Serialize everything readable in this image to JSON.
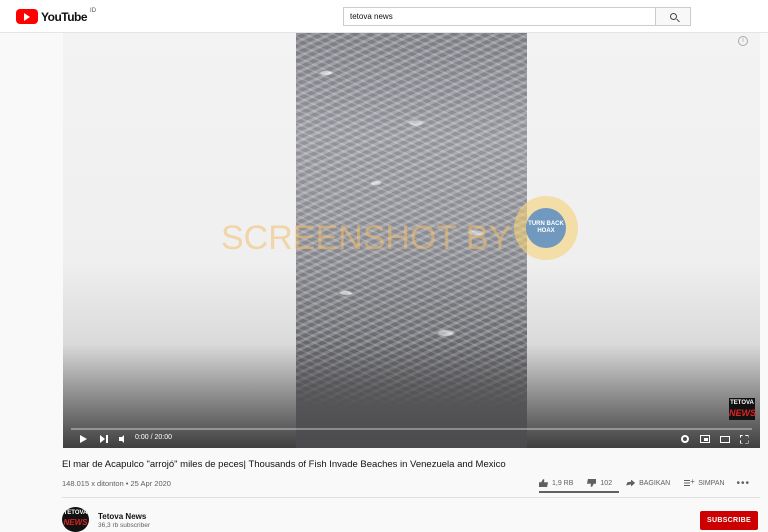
{
  "header": {
    "logo_text": "YouTube",
    "logo_sup": "ID",
    "search_value": "tetova news"
  },
  "player": {
    "watermark_text": "SCREENSHOT BY",
    "seal_text": "TURN BACK HOAX",
    "channel_watermark_top": "TETOVA",
    "channel_watermark_bottom": "NEWS",
    "time": "0:00 / 20:00",
    "progress_fraction": 0
  },
  "video": {
    "title": "El mar de Acapulco \"arrojó\" miles de peces| Thousands of Fish Invade Beaches in Venezuela and Mexico",
    "meta": "148.015 x ditonton • 25 Apr 2020",
    "likes": "1,9 RB",
    "dislikes": "102",
    "share_label": "BAGIKAN",
    "save_label": "SIMPAN",
    "more_label": "•••"
  },
  "channel": {
    "avatar_top": "TETOVA",
    "avatar_bottom": "NEWS",
    "name": "Tetova News",
    "subscribers": "36,3 rb subscriber",
    "subscribe_label": "SUBSCRIBE"
  },
  "icons": {
    "search": "search-icon",
    "play": "play-icon",
    "next": "next-icon",
    "volume": "volume-icon",
    "settings": "gear-icon",
    "miniplayer": "miniplayer-icon",
    "theater": "theater-icon",
    "fullscreen": "fullscreen-icon",
    "like": "thumbs-up-icon",
    "dislike": "thumbs-down-icon",
    "share": "share-icon",
    "save": "save-playlist-icon"
  },
  "colors": {
    "brand": "#ff0000",
    "subscribe": "#cc0000"
  }
}
